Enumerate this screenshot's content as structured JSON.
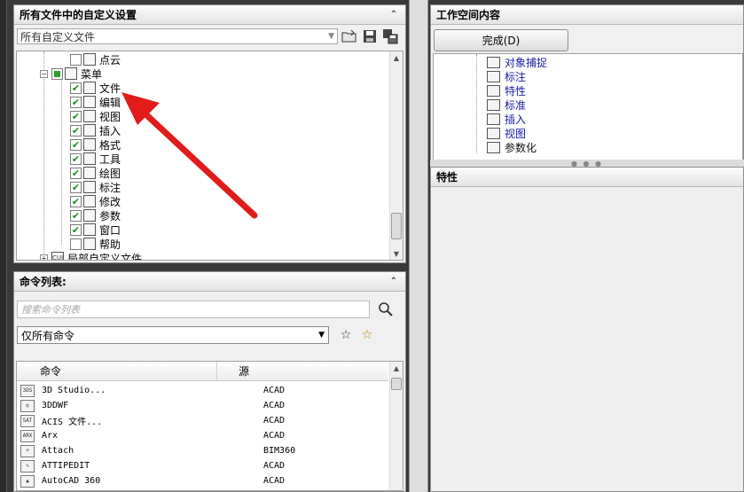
{
  "customize_panel": {
    "title": "所有文件中的自定义设置",
    "file_select": "所有自定义文件",
    "tree": [
      {
        "label": "点云",
        "level": 3,
        "checked": false
      },
      {
        "label": "菜单",
        "level": 2,
        "partial": true,
        "expander": "−"
      },
      {
        "label": "文件",
        "level": 3,
        "checked": true
      },
      {
        "label": "编辑",
        "level": 3,
        "checked": true
      },
      {
        "label": "视图",
        "level": 3,
        "checked": true
      },
      {
        "label": "插入",
        "level": 3,
        "checked": true
      },
      {
        "label": "格式",
        "level": 3,
        "checked": true
      },
      {
        "label": "工具",
        "level": 3,
        "checked": true
      },
      {
        "label": "绘图",
        "level": 3,
        "checked": true
      },
      {
        "label": "标注",
        "level": 3,
        "checked": true
      },
      {
        "label": "修改",
        "level": 3,
        "checked": true
      },
      {
        "label": "参数",
        "level": 3,
        "checked": true
      },
      {
        "label": "窗口",
        "level": 3,
        "checked": true
      },
      {
        "label": "帮助",
        "level": 3,
        "checked": false
      },
      {
        "label": "局部自定义文件",
        "level": 1,
        "expander": "+",
        "doc": "CUI"
      }
    ]
  },
  "command_panel": {
    "title": "命令列表:",
    "search_placeholder": "搜索命令列表",
    "filter": "仅所有命令",
    "columns": [
      "命令",
      "源"
    ],
    "rows": [
      {
        "name": "3D Studio...",
        "src": "ACAD",
        "icon": "3DS"
      },
      {
        "name": "3DDWF",
        "src": "ACAD",
        "icon": "◎"
      },
      {
        "name": "ACIS 文件...",
        "src": "ACAD",
        "icon": "SAT"
      },
      {
        "name": "Arx",
        "src": "ACAD",
        "icon": "ARX"
      },
      {
        "name": "Attach",
        "src": "BIM360",
        "icon": "+"
      },
      {
        "name": "ATTIPEDIT",
        "src": "ACAD",
        "icon": "✎"
      },
      {
        "name": "AutoCAD 360",
        "src": "ACAD",
        "icon": "▲"
      }
    ]
  },
  "workspace_panel": {
    "title": "工作空间内容",
    "finish_button": "完成(D)",
    "items": [
      {
        "label": "对象捕捉",
        "color": "blue"
      },
      {
        "label": "标注",
        "color": "blue"
      },
      {
        "label": "特性",
        "color": "blue"
      },
      {
        "label": "标准",
        "color": "blue"
      },
      {
        "label": "插入",
        "color": "blue"
      },
      {
        "label": "视图",
        "color": "blue"
      },
      {
        "label": "参数化",
        "color": "black"
      }
    ]
  },
  "properties_panel": {
    "title": "特性"
  },
  "icons": {
    "collapse": "collapse-up-icon",
    "open_file": "open-folder-icon",
    "save": "save-icon",
    "save_as": "save-as-icon",
    "search": "magnifier-icon",
    "star_search": "star-search-icon",
    "star_new": "star-new-icon"
  },
  "colors": {
    "checkmark": "#1a8f1a",
    "link": "#1a1aa6",
    "arrow": "#e21b1b"
  }
}
